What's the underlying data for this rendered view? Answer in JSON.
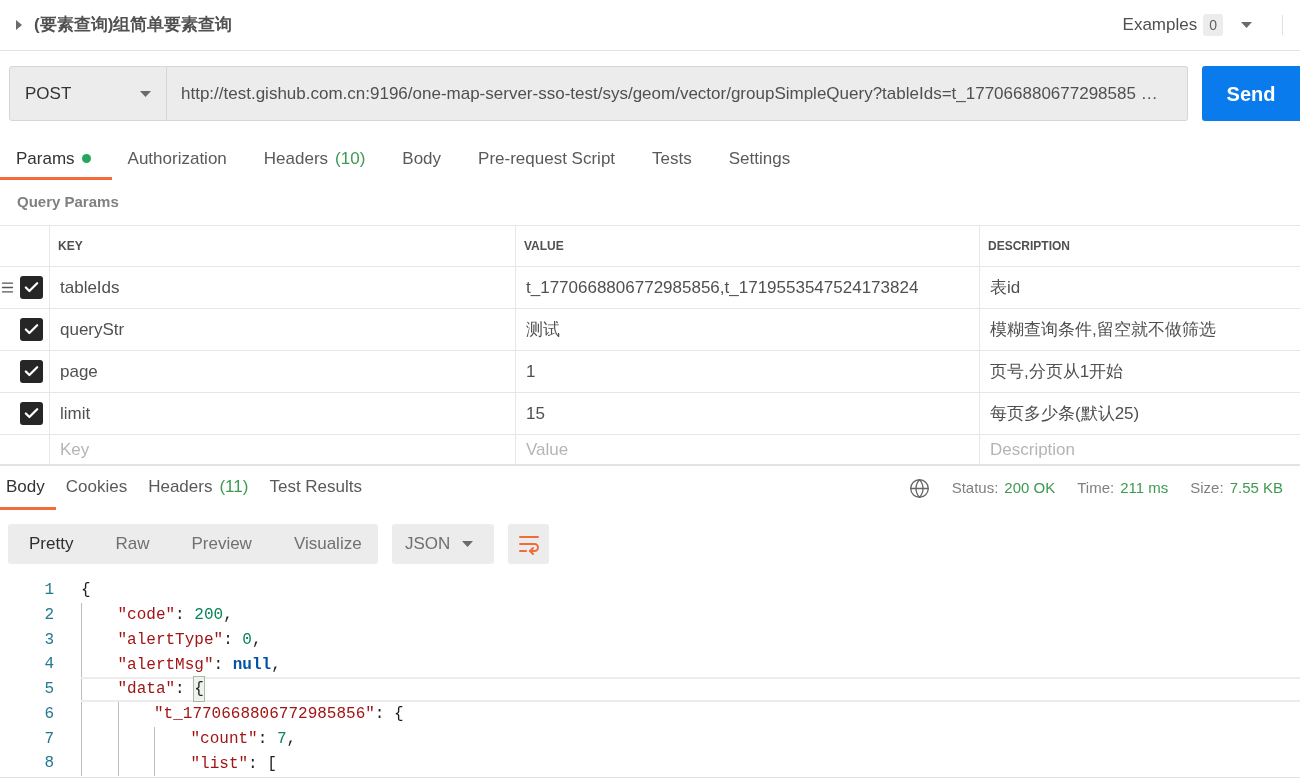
{
  "request": {
    "title": "(要素查询)组简单要素查询",
    "expanded": false
  },
  "examples": {
    "label": "Examples",
    "count": "0"
  },
  "url_bar": {
    "method": "POST",
    "url": "http://test.gishub.com.cn:9196/one-map-server-sso-test/sys/geom/vector/groupSimpleQuery?tableIds=t_177066880677298585 …",
    "send": "Send"
  },
  "request_tabs": [
    {
      "label": "Params",
      "indicator": true,
      "selected": true
    },
    {
      "label": "Authorization",
      "indicator": false,
      "selected": false
    },
    {
      "label": "Headers",
      "count": "(10)",
      "indicator": false,
      "selected": false
    },
    {
      "label": "Body",
      "indicator": false,
      "selected": false
    },
    {
      "label": "Pre-request Script",
      "indicator": false,
      "selected": false
    },
    {
      "label": "Tests",
      "indicator": false,
      "selected": false
    },
    {
      "label": "Settings",
      "indicator": false,
      "selected": false
    }
  ],
  "query_params": {
    "title": "Query Params",
    "columns": [
      "KEY",
      "VALUE",
      "DESCRIPTION"
    ],
    "rows": [
      {
        "drag_handle": true,
        "checked": true,
        "key": "tableIds",
        "value": "t_1770668806772985856,t_1719553547524173824",
        "description": "表id"
      },
      {
        "drag_handle": false,
        "checked": true,
        "key": "queryStr",
        "value": "测试",
        "description": "模糊查询条件,留空就不做筛选"
      },
      {
        "drag_handle": false,
        "checked": true,
        "key": "page",
        "value": "1",
        "description": "页号,分页从1开始"
      },
      {
        "drag_handle": false,
        "checked": true,
        "key": "limit",
        "value": "15",
        "description": "每页多少条(默认25)"
      }
    ],
    "new_row": {
      "key_placeholder": "Key",
      "value_placeholder": "Value",
      "description_placeholder": "Description"
    }
  },
  "response_tabs": [
    {
      "label": "Body",
      "selected": true
    },
    {
      "label": "Cookies",
      "selected": false
    },
    {
      "label": "Headers",
      "count": "(11)",
      "selected": false
    },
    {
      "label": "Test Results",
      "selected": false
    }
  ],
  "response_meta": [
    {
      "label": "Status:",
      "value": "200 OK"
    },
    {
      "label": "Time:",
      "value": "211 ms"
    },
    {
      "label": "Size:",
      "value": "7.55 KB"
    }
  ],
  "view_modes": [
    {
      "label": "Pretty",
      "selected": true
    },
    {
      "label": "Raw",
      "selected": false
    },
    {
      "label": "Preview",
      "selected": false
    },
    {
      "label": "Visualize",
      "selected": false
    }
  ],
  "format": "JSON",
  "wrap_lines": true,
  "code_lines": [
    {
      "number": "1",
      "highlighted": false,
      "tokens": [
        {
          "kind": "punct",
          "text": "{"
        }
      ],
      "children": [
        {
          "number": "2",
          "highlighted": false,
          "tokens": [
            {
              "kind": "key",
              "text": "\"code\""
            },
            {
              "kind": "punct",
              "text": ": "
            },
            {
              "kind": "number",
              "text": "200"
            },
            {
              "kind": "punct",
              "text": ","
            }
          ]
        },
        {
          "number": "3",
          "highlighted": false,
          "tokens": [
            {
              "kind": "key",
              "text": "\"alertType\""
            },
            {
              "kind": "punct",
              "text": ": "
            },
            {
              "kind": "number",
              "text": "0"
            },
            {
              "kind": "punct",
              "text": ","
            }
          ]
        },
        {
          "number": "4",
          "highlighted": false,
          "tokens": [
            {
              "kind": "key",
              "text": "\"alertMsg\""
            },
            {
              "kind": "punct",
              "text": ": "
            },
            {
              "kind": "null",
              "text": "null"
            },
            {
              "kind": "punct",
              "text": ","
            }
          ]
        },
        {
          "number": "5",
          "highlighted": true,
          "tokens": [
            {
              "kind": "key",
              "text": "\"data\""
            },
            {
              "kind": "punct",
              "text": ": "
            },
            {
              "kind": "matched_bracket",
              "text": "{"
            }
          ],
          "children": [
            {
              "number": "6",
              "highlighted": false,
              "tokens": [
                {
                  "kind": "key",
                  "text": "\"t_1770668806772985856\""
                },
                {
                  "kind": "punct",
                  "text": ": "
                },
                {
                  "kind": "punct",
                  "text": "{"
                }
              ],
              "children": [
                {
                  "number": "7",
                  "highlighted": false,
                  "tokens": [
                    {
                      "kind": "key",
                      "text": "\"count\""
                    },
                    {
                      "kind": "punct",
                      "text": ": "
                    },
                    {
                      "kind": "number",
                      "text": "7"
                    },
                    {
                      "kind": "punct",
                      "text": ","
                    }
                  ]
                },
                {
                  "number": "8",
                  "highlighted": false,
                  "tokens": [
                    {
                      "kind": "key",
                      "text": "\"list\""
                    },
                    {
                      "kind": "punct",
                      "text": ": "
                    },
                    {
                      "kind": "punct",
                      "text": "["
                    }
                  ]
                }
              ]
            }
          ]
        }
      ]
    }
  ]
}
